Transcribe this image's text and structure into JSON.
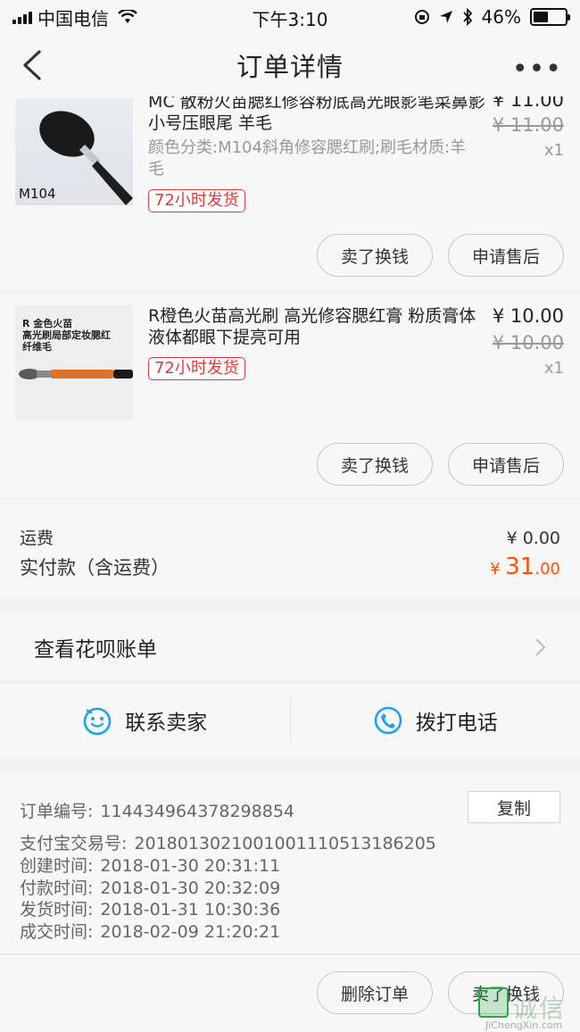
{
  "status_bar": {
    "carrier": "中国电信",
    "time": "下午3:10",
    "battery": "46%",
    "battery_level": 0.46
  },
  "nav": {
    "title": "订单详情",
    "more": "•••"
  },
  "products": [
    {
      "thumb_label": "M104",
      "title": "MC 散粉火苗腮红修容粉底高光眼影笔菜鼻影小号压眼尾 羊毛",
      "price": "¥ 11.00",
      "original_price": "¥ 11.00",
      "qty": "x1",
      "sku": "颜色分类:M104斜角修容腮红刷;刷毛材质:羊毛",
      "tag": "72小时发货",
      "btn_sell": "卖了换钱",
      "btn_after_sale": "申请售后"
    },
    {
      "thumb_label": "R 金色火苗\n高光刷局部定妆腮红\n纤维毛",
      "title": "R橙色火苗高光刷 高光修容腮红膏 粉质膏体液体都眼下提亮可用",
      "price": "¥ 10.00",
      "original_price": "¥ 10.00",
      "qty": "x1",
      "tag": "72小时发货",
      "btn_sell": "卖了换钱",
      "btn_after_sale": "申请售后"
    }
  ],
  "totals": {
    "shipping_label": "运费",
    "shipping_value": "¥ 0.00",
    "paid_label": "实付款（含运费）",
    "paid_currency": "¥ ",
    "paid_int": "31",
    "paid_dec": ".00"
  },
  "huabei": {
    "label": "查看花呗账单"
  },
  "contact": {
    "seller": "联系卖家",
    "phone": "拨打电话"
  },
  "order_info": {
    "order_no_label": "订单编号:",
    "order_no": "114434964378298854",
    "copy_label": "复制",
    "alipay_label": "支付宝交易号:",
    "alipay_no": "2018013021001001110513186205",
    "created_label": "创建时间:",
    "created": "2018-01-30 20:31:11",
    "paid_label": "付款时间:",
    "paid": "2018-01-30 20:32:09",
    "shipped_label": "发货时间:",
    "shipped": "2018-01-31 10:30:36",
    "done_label": "成交时间:",
    "done": "2018-02-09 21:20:21"
  },
  "bottom": {
    "delete_order": "删除订单",
    "sell": "卖了换钱"
  },
  "watermark": {
    "text": "诚信",
    "url": "JiChengXin.com"
  },
  "colors": {
    "accent_orange": "#ff5000",
    "tag_red": "#e4393c",
    "icon_blue": "#1da1f2"
  }
}
